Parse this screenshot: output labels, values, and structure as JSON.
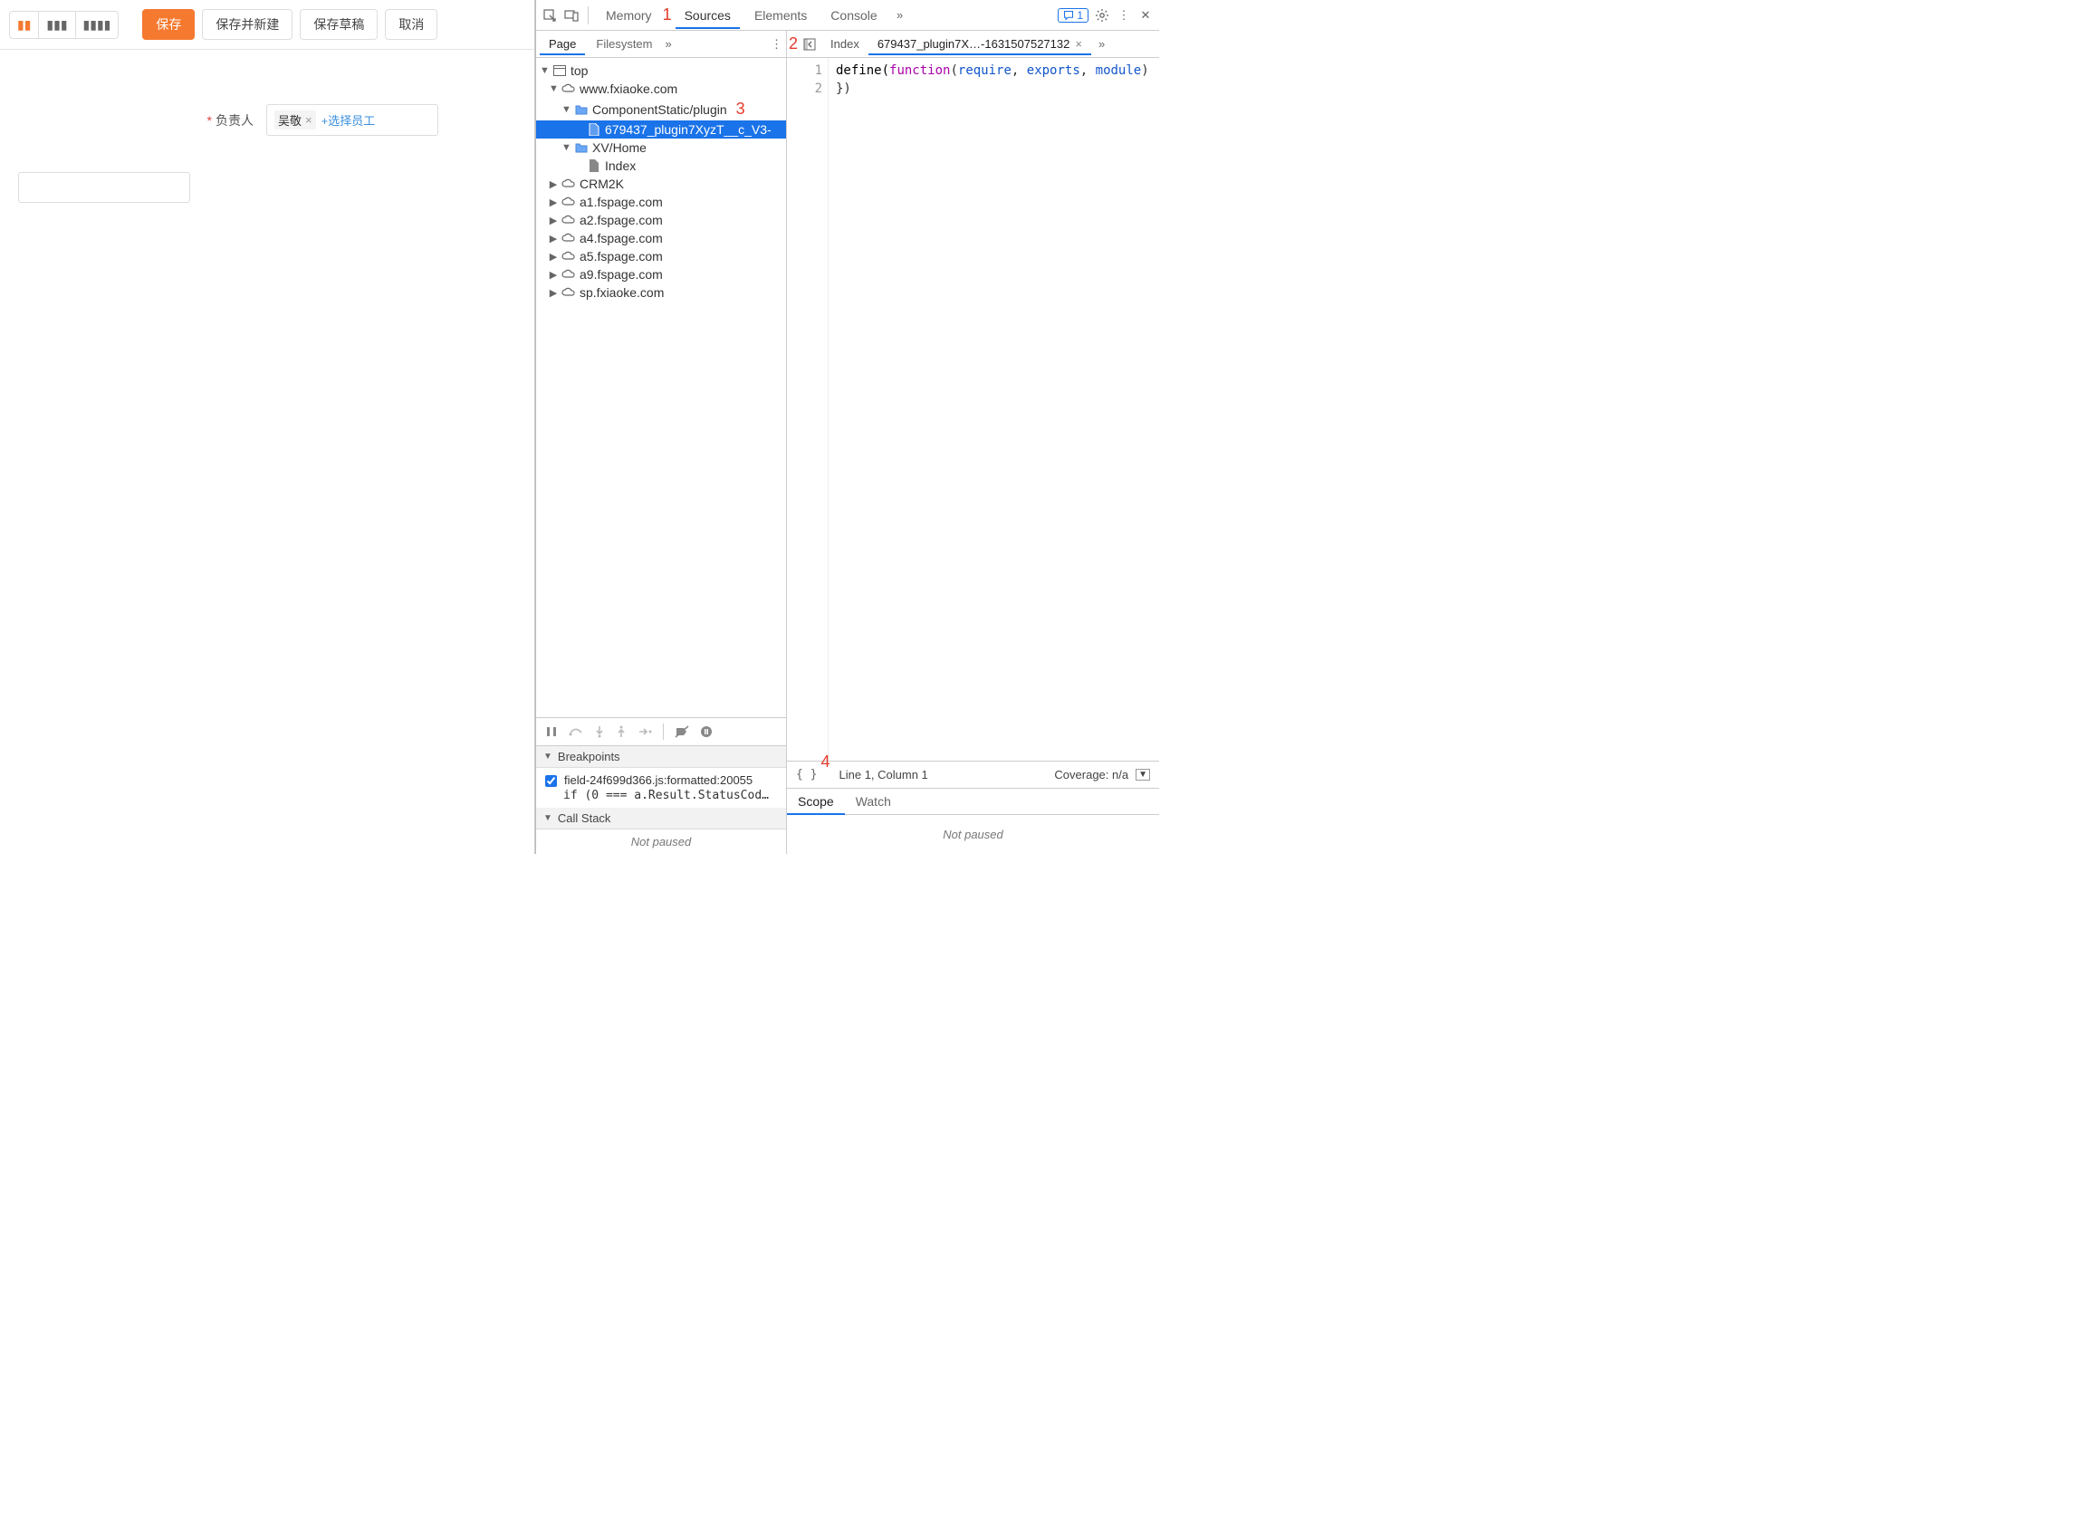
{
  "app": {
    "toolbar": {
      "save": "保存",
      "saveAndNew": "保存并新建",
      "saveDraft": "保存草稿",
      "cancel": "取消"
    },
    "form": {
      "owner_label": "负责人",
      "owner_tag": "吴敬",
      "add_employee": "+选择员工"
    }
  },
  "annotations": {
    "m1": "1",
    "m2": "2",
    "m3": "3",
    "m4": "4"
  },
  "devtools": {
    "topTabs": {
      "memory": "Memory",
      "sources": "Sources",
      "elements": "Elements",
      "console": "Console"
    },
    "badge_count": "1",
    "leftTabs": {
      "page": "Page",
      "filesystem": "Filesystem"
    },
    "tree": {
      "top": "top",
      "d1": "www.fxiaoke.com",
      "d1_f1": "ComponentStatic/plugin",
      "d1_f1_file": "679437_plugin7XyzT__c_V3-",
      "d1_f2": "XV/Home",
      "d1_f2_file": "Index",
      "d2": "CRM2K",
      "d3": "a1.fspage.com",
      "d4": "a2.fspage.com",
      "d5": "a4.fspage.com",
      "d6": "a5.fspage.com",
      "d7": "a9.fspage.com",
      "d8": "sp.fxiaoke.com"
    },
    "editorTabs": {
      "index": "Index",
      "plugin": "679437_plugin7X…-1631507527132"
    },
    "code": {
      "l1_a": "define(",
      "l1_b": "function",
      "l1_c": "(",
      "l1_d": "require",
      "l1_e": ", ",
      "l1_f": "exports",
      "l1_g": ", ",
      "l1_h": "module",
      "l1_i": ")",
      "l2": "})",
      "ln1": "1",
      "ln2": "2"
    },
    "status": {
      "line_col": "Line 1, Column 1",
      "coverage": "Coverage: n/a"
    },
    "breakpoints": {
      "title": "Breakpoints",
      "bp1_name": "field-24f699d366.js:formatted:20055",
      "bp1_code": "if (0 === a.Result.StatusCod…"
    },
    "callstack": {
      "title": "Call Stack",
      "not_paused": "Not paused"
    },
    "scope": {
      "scope": "Scope",
      "watch": "Watch",
      "not_paused": "Not paused"
    }
  }
}
